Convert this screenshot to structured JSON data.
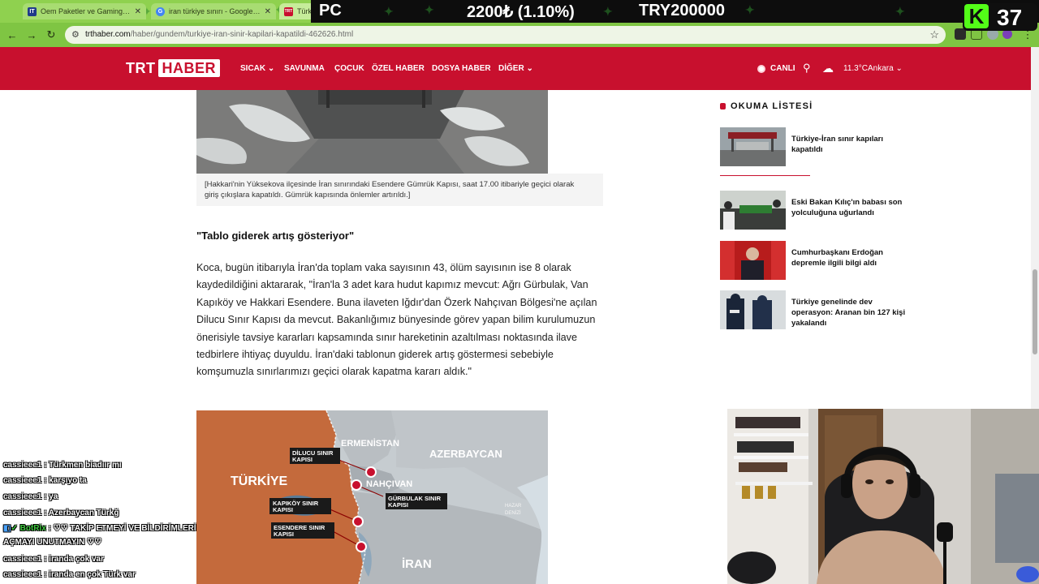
{
  "browser": {
    "tabs": [
      {
        "title": "Oem Paketler ve Gaming Bilgis",
        "favicon": "IT",
        "favcolor": "#1f3a8a"
      },
      {
        "title": "iran türkiye sınırı - Google'da",
        "favicon": "G",
        "favcolor": "#4285f4"
      },
      {
        "title": "Türkiye",
        "favicon": "TRT",
        "favcolor": "#c8102e"
      }
    ],
    "url_domain": "trthaber.com",
    "url_path": "/haber/gundem/turkiye-iran-sinir-kapilari-kapatildi-462626.html"
  },
  "stream_banner": {
    "text_pc": "PC",
    "text_price": "2200₺ (1.10%)",
    "text_goal": "TRY200000"
  },
  "kick": {
    "viewers": "37"
  },
  "site": {
    "logo_trt": "TRT",
    "logo_haber": "HABER",
    "nav": [
      "SICAK",
      "SAVUNMA",
      "ÇOCUK",
      "ÖZEL HABER",
      "DOSYA HABER",
      "DİĞER"
    ],
    "live_label": "CANLI",
    "weather_temp": "11.3°C",
    "weather_city": "Ankara"
  },
  "article": {
    "caption": "[Hakkari'nin Yüksekova ilçesinde İran sınırındaki Esendere Gümrük Kapısı, saat 17.00 itibariyle geçici olarak giriş çıkışlara kapatıldı. Gümrük kapısında önlemler artırıldı.]",
    "subheading": "\"Tablo giderek artış gösteriyor\"",
    "body": "Koca, bugün itibarıyla İran'da toplam vaka sayısının 43, ölüm sayısının ise 8 olarak kaydedildiğini aktararak, \"İran'la 3 adet kara hudut kapımız mevcut: Ağrı Gürbulak, Van Kapıköy ve Hakkari Esendere. Buna ilaveten Iğdır'dan Özerk Nahçıvan Bölgesi'ne açılan Dilucu Sınır Kapısı da mevcut. Bakanlığımız bünyesinde görev yapan bilim kurulumuzun önerisiyle tavsiye kararları kapsamında sınır hareketinin azaltılması noktasında ilave tedbirlere ihtiyaç duyuldu. İran'daki tablonun giderek artış göstermesi sebebiyle komşumuzla sınırlarımızı geçici olarak kapatma kararı aldık.\"",
    "map_labels": {
      "turkiye": "TÜRKİYE",
      "ermenistan": "ERMENİSTAN",
      "azerbaycan": "AZERBAYCAN",
      "nahcivan": "NAHÇIVAN",
      "iran": "İRAN",
      "hazar_1": "HAZAR",
      "hazar_2": "DENİZİ",
      "dilucu_1": "DİLUCU SINIR",
      "dilucu_2": "KAPISI",
      "gurbulak_1": "GÜRBULAK SINIR",
      "gurbulak_2": "KAPISI",
      "kapikoy_1": "KAPIKÖY SINIR",
      "kapikoy_2": "KAPISI",
      "esendere_1": "ESENDERE SINIR",
      "esendere_2": "KAPISI"
    }
  },
  "sidebar": {
    "title": "OKUMA LİSTESİ",
    "items": [
      {
        "title": "Türkiye-İran sınır kapıları kapatıldı"
      },
      {
        "title": "Eski Bakan Kılıç'ın babası son yolculuğuna uğurlandı"
      },
      {
        "title": "Cumhurbaşkanı Erdoğan depremle ilgili bilgi aldı"
      },
      {
        "title": "Türkiye genelinde dev operasyon: Aranan bin 127 kişi yakalandı"
      }
    ]
  },
  "chat": [
    {
      "user": "cassieee1",
      "msg": ": Türkmen biadıır mı"
    },
    {
      "user": "cassieee1",
      "msg": ": karşıyo ta"
    },
    {
      "user": "cassieee1",
      "msg": ": ya"
    },
    {
      "user": "cassieee1",
      "msg": ": Azerbaycan Türkğ"
    },
    {
      "user": "BotRix",
      "msg": ": ♡♡ TAKİP ETMEYİ VE BİLDİRİMLERİ"
    },
    {
      "user": "",
      "msg": "AÇMAYI UNUTMAYIN ♡♡"
    },
    {
      "user": "cassieee1",
      "msg": ": iranda çok var"
    },
    {
      "user": "cassieee1",
      "msg": ": iranda en çok Türk var"
    }
  ]
}
